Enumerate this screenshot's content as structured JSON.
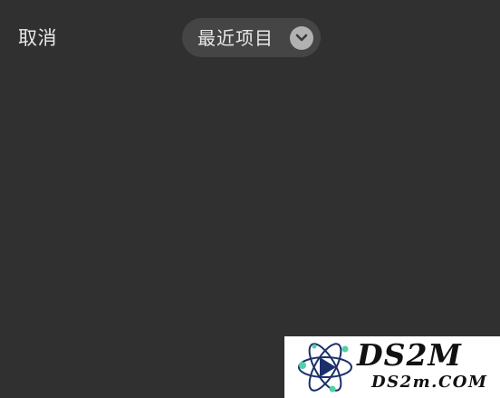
{
  "header": {
    "cancel_label": "取消",
    "album_picker_label": "最近项目"
  },
  "watermark": {
    "title": "DS2M",
    "domain": "DS2m.COM"
  },
  "colors": {
    "background": "#303030",
    "picker_background": "#454545",
    "text": "#e9e9e9",
    "chevron_circle": "#b1b1b1"
  },
  "icons": {
    "album_picker": "chevron-down-circle-icon",
    "watermark": "atom-play-logo"
  }
}
